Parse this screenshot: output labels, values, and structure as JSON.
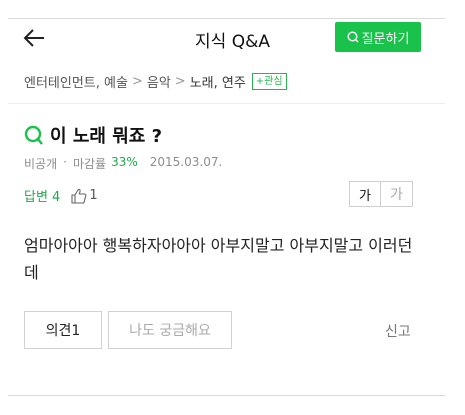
{
  "header": {
    "title": "지식 Q&A",
    "ask_button_label": "질문하기",
    "back_icon": "arrow-left-icon"
  },
  "breadcrumb": {
    "items": [
      "엔터테인먼트, 예술",
      "음악",
      "노래, 연주"
    ],
    "separator": ">",
    "interest_label": "+관심"
  },
  "question": {
    "title": "이 노래 뭐죠 ?",
    "visibility": "비공개",
    "rate_label": "마감률",
    "rate_value": "33%",
    "date": "2015.03.07.",
    "answers_label": "답변 4",
    "likes": "1",
    "body": "엄마아아아 행복하자아아아 아부지말고 아부지말고 이러던데"
  },
  "font_toggle": {
    "normal": "가",
    "large": "가"
  },
  "actions": {
    "opinion_label": "의견1",
    "curious_label": "나도 궁금해요",
    "report_label": "신고"
  },
  "colors": {
    "accent": "#19c24a",
    "accent_text": "#1ea84b"
  }
}
